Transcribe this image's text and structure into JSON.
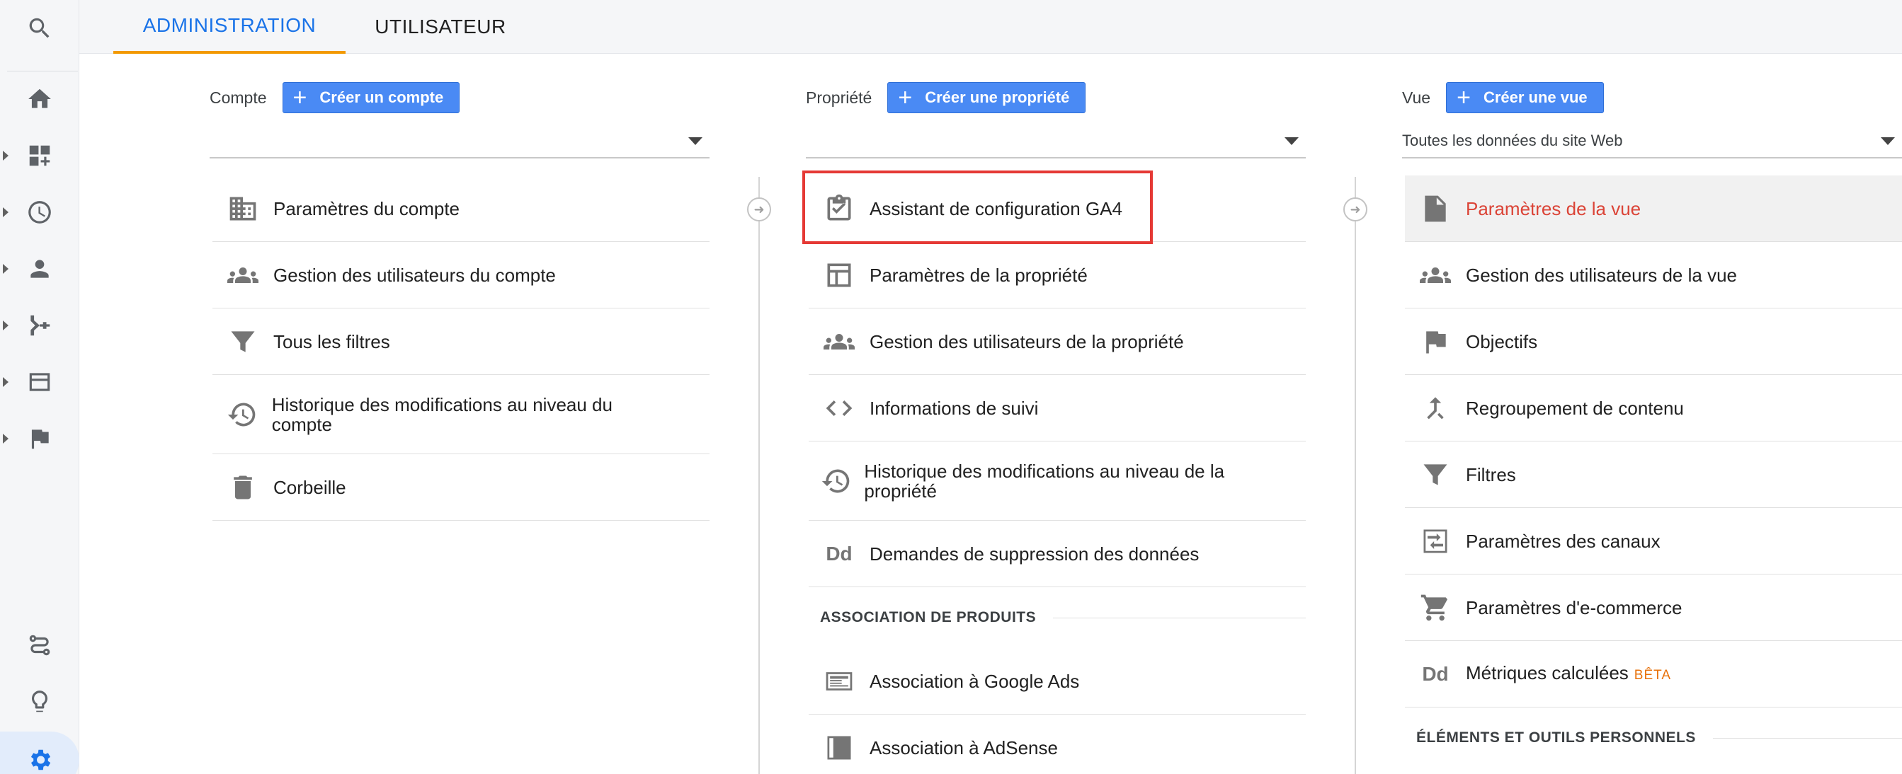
{
  "tabs": {
    "admin": "ADMINISTRATION",
    "user": "UTILISATEUR"
  },
  "account": {
    "label": "Compte",
    "create_button": "Créer un compte",
    "selected": "",
    "items": [
      {
        "label": "Paramètres du compte",
        "icon": "building-icon"
      },
      {
        "label": "Gestion des utilisateurs du compte",
        "icon": "people-icon"
      },
      {
        "label": "Tous les filtres",
        "icon": "filter-icon"
      },
      {
        "label": "Historique des modifications au niveau du compte",
        "icon": "history-icon"
      },
      {
        "label": "Corbeille",
        "icon": "trash-icon"
      }
    ]
  },
  "property": {
    "label": "Propriété",
    "create_button": "Créer une propriété",
    "selected": "",
    "items": [
      {
        "label": "Assistant de configuration GA4",
        "icon": "clipboard-check-icon"
      },
      {
        "label": "Paramètres de la propriété",
        "icon": "layout-icon"
      },
      {
        "label": "Gestion des utilisateurs de la propriété",
        "icon": "people-icon"
      },
      {
        "label": "Informations de suivi",
        "icon": "code-icon"
      },
      {
        "label": "Historique des modifications au niveau de la propriété",
        "icon": "history-icon"
      },
      {
        "label": "Demandes de suppression des données",
        "icon": "dd-icon",
        "icon_text": "Dd"
      }
    ],
    "section": "ASSOCIATION DE PRODUITS",
    "product_links": [
      {
        "label": "Association à Google Ads",
        "icon": "google-ads-icon"
      },
      {
        "label": "Association à AdSense",
        "icon": "adsense-icon"
      }
    ]
  },
  "view": {
    "label": "Vue",
    "create_button": "Créer une vue",
    "selected": "Toutes les données du site Web",
    "items": [
      {
        "label": "Paramètres de la vue",
        "icon": "document-icon"
      },
      {
        "label": "Gestion des utilisateurs de la vue",
        "icon": "people-icon"
      },
      {
        "label": "Objectifs",
        "icon": "flag-icon"
      },
      {
        "label": "Regroupement de contenu",
        "icon": "merge-icon"
      },
      {
        "label": "Filtres",
        "icon": "filter-icon"
      },
      {
        "label": "Paramètres des canaux",
        "icon": "channel-icon"
      },
      {
        "label": "Paramètres d'e-commerce",
        "icon": "cart-icon"
      },
      {
        "label": "Métriques calculées",
        "icon": "dd-icon",
        "icon_text": "Dd",
        "badge": "BÊTA"
      }
    ],
    "section": "ÉLÉMENTS ET OUTILS PERSONNELS"
  },
  "colors": {
    "accent": "#1a73e8",
    "tab_underline": "#f29900",
    "button": "#4a8af4",
    "active_item": "#db4437",
    "highlight_box": "#e53935"
  }
}
